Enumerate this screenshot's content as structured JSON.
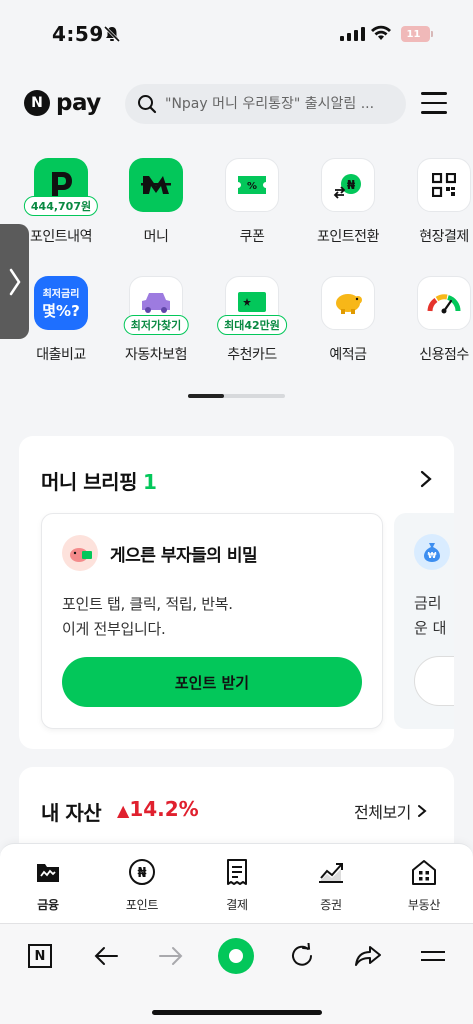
{
  "status_bar": {
    "time": "4:59",
    "battery": "11"
  },
  "header": {
    "logo_badge": "N",
    "logo_text": "pay",
    "search_placeholder": "\"Npay 머니 우리통장\" 출시알림 ..."
  },
  "quick_menu": [
    {
      "label": "포인트내역",
      "badge": "444,707원",
      "icon": "points-p-icon"
    },
    {
      "label": "머니",
      "icon": "money-m-icon"
    },
    {
      "label": "쿠폰",
      "icon": "coupon-icon"
    },
    {
      "label": "포인트전환",
      "icon": "point-exchange-icon"
    },
    {
      "label": "현장결제",
      "icon": "qr-code-icon"
    },
    {
      "label": "대출비교",
      "tile_line1": "최저금리",
      "tile_line2": "몇%?",
      "icon": "loan-compare-icon"
    },
    {
      "label": "자동차보험",
      "badge": "최저가찾기",
      "icon": "car-insurance-icon"
    },
    {
      "label": "추천카드",
      "badge": "최대42만원",
      "icon": "card-recommend-icon"
    },
    {
      "label": "예적금",
      "icon": "piggy-bank-icon"
    },
    {
      "label": "신용점수",
      "icon": "credit-gauge-icon"
    }
  ],
  "briefing": {
    "title": "머니 브리핑",
    "count": "1",
    "card": {
      "title": "게으른 부자들의 비밀",
      "body_line1": "포인트 탭, 클릭, 적립, 반복.",
      "body_line2": "이게 전부입니다.",
      "button": "포인트 받기"
    },
    "peek": {
      "line1": "금리",
      "line2": "운 대"
    }
  },
  "assets": {
    "title": "내 자산",
    "change": "14.2%",
    "view_all": "전체보기"
  },
  "tabs": [
    {
      "label": "금융",
      "icon": "finance-wallet-icon",
      "active": true
    },
    {
      "label": "포인트",
      "icon": "point-coin-icon"
    },
    {
      "label": "결제",
      "icon": "receipt-icon"
    },
    {
      "label": "증권",
      "icon": "stock-chart-icon"
    },
    {
      "label": "부동산",
      "icon": "real-estate-icon"
    }
  ],
  "browser": {
    "home_label": "N"
  },
  "colors": {
    "brand_green": "#03c75a",
    "down_red": "#e0202e"
  }
}
